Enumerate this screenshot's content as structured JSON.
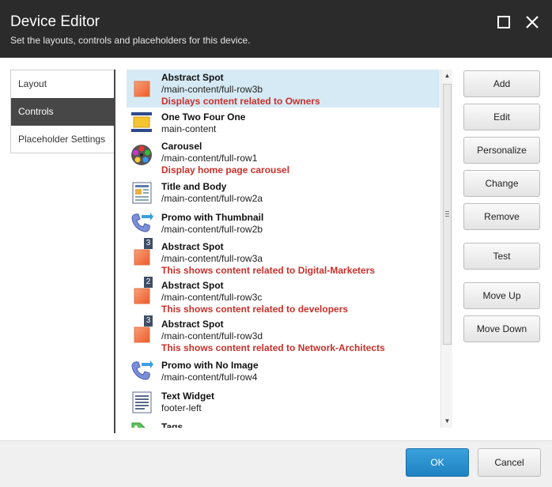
{
  "window": {
    "title": "Device Editor",
    "subtitle": "Set the layouts, controls and placeholders for this device."
  },
  "tabs": [
    {
      "label": "Layout"
    },
    {
      "label": "Controls"
    },
    {
      "label": "Placeholder Settings"
    }
  ],
  "controls": [
    {
      "name": "Abstract Spot",
      "path": "/main-content/full-row3b",
      "desc": "Displays content related to Owners",
      "icon": "abstract-spot-icon",
      "selected": true
    },
    {
      "name": "One Two Four One",
      "path": "main-content",
      "desc": "",
      "icon": "one-two-four-one-icon"
    },
    {
      "name": "Carousel",
      "path": "/main-content/full-row1",
      "desc": "Display home page carousel",
      "icon": "film-reel-icon"
    },
    {
      "name": "Title and Body",
      "path": "/main-content/full-row2a",
      "desc": "",
      "icon": "document-layout-icon"
    },
    {
      "name": "Promo with Thumbnail",
      "path": "/main-content/full-row2b",
      "desc": "",
      "icon": "phone-arrow-icon"
    },
    {
      "name": "Abstract Spot",
      "path": "/main-content/full-row3a",
      "desc": "This shows content related to Digital-Marketers",
      "icon": "abstract-spot-icon",
      "badge": "3"
    },
    {
      "name": "Abstract Spot",
      "path": "/main-content/full-row3c",
      "desc": "This shows content related to developers",
      "icon": "abstract-spot-icon",
      "badge": "2"
    },
    {
      "name": "Abstract Spot",
      "path": "/main-content/full-row3d",
      "desc": "This shows content related to Network-Architects",
      "icon": "abstract-spot-icon",
      "badge": "3"
    },
    {
      "name": "Promo with No Image",
      "path": "/main-content/full-row4",
      "desc": "",
      "icon": "phone-arrow-icon"
    },
    {
      "name": "Text Widget",
      "path": "footer-left",
      "desc": "",
      "icon": "text-document-icon"
    },
    {
      "name": "Tags",
      "path": "",
      "desc": "",
      "icon": "tag-icon"
    }
  ],
  "buttons": {
    "add": "Add",
    "edit": "Edit",
    "personalize": "Personalize",
    "change": "Change",
    "remove": "Remove",
    "test": "Test",
    "move_up": "Move Up",
    "move_down": "Move Down"
  },
  "footer": {
    "ok": "OK",
    "cancel": "Cancel"
  },
  "colors": {
    "titlebar": "#2b2b2b",
    "active_tab": "#474747",
    "selected_row": "#d6eaf5",
    "desc_text": "#c8302a",
    "ok_button": "#2a8fcc"
  }
}
